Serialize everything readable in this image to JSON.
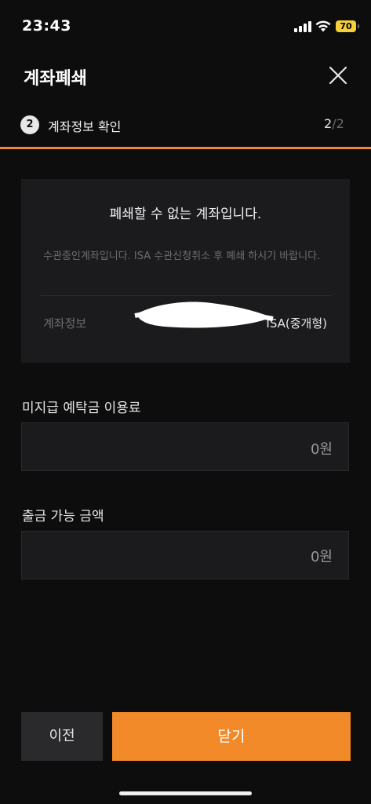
{
  "status_bar": {
    "time": "23:43",
    "battery": "70"
  },
  "header": {
    "title": "계좌폐쇄"
  },
  "step": {
    "number": "2",
    "label": "계좌정보 확인",
    "current": "2",
    "total": "/2"
  },
  "notice": {
    "title": "폐쇄할 수 없는 계좌입니다.",
    "description": "수관중인계좌입니다. ISA 수관신청취소 후 폐쇄 하시기 바랍니다.",
    "account_label": "계좌정보",
    "account_value": "ISA(중개형)"
  },
  "fields": [
    {
      "label": "미지급 예탁금 이용료",
      "value": "0원"
    },
    {
      "label": "출금 가능 금액",
      "value": "0원"
    }
  ],
  "buttons": {
    "prev": "이전",
    "close": "닫기"
  },
  "colors": {
    "accent": "#f28a2a",
    "background": "#0d0d0d",
    "card": "#1b1b1d"
  }
}
